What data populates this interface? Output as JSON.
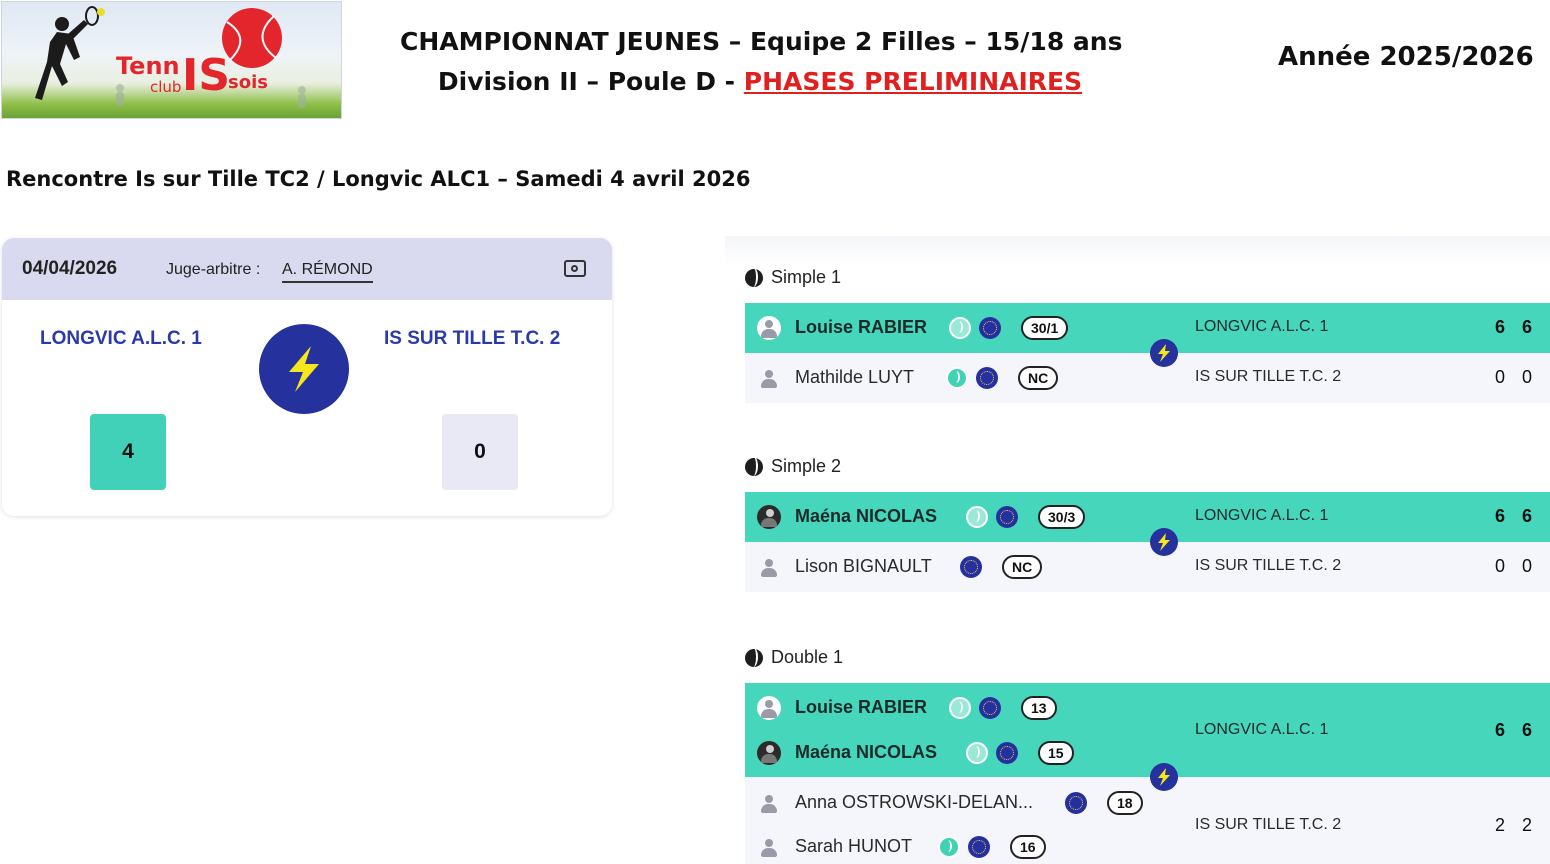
{
  "header": {
    "logo_text": "TennISclub ISsois",
    "title_line1": "CHAMPIONNAT JEUNES – Equipe 2 Filles – 15/18 ans",
    "title_line2_prefix": "Division II – Poule D - ",
    "title_line2_highlight": "PHASES PRELIMINAIRES",
    "season": "Année 2025/2026"
  },
  "encounter_title": "Rencontre Is sur Tille TC2 / Longvic ALC1 – Samedi 4 avril 2026",
  "summary": {
    "date": "04/04/2026",
    "judge_label": "Juge-arbitre :",
    "judge_name": "A. RÉMOND",
    "home_team": "LONGVIC A.L.C. 1",
    "away_team": "IS SUR TILLE T.C. 2",
    "home_score": "4",
    "away_score": "0"
  },
  "matches": [
    {
      "title": "Simple 1",
      "winner": {
        "players": [
          {
            "name": "Louise RABIER",
            "rank": "30/1"
          }
        ],
        "club": "LONGVIC A.L.C. 1",
        "sets": [
          "6",
          "6"
        ]
      },
      "loser": {
        "players": [
          {
            "name": "Mathilde LUYT",
            "rank": "NC"
          }
        ],
        "club": "IS SUR TILLE T.C. 2",
        "sets": [
          "0",
          "0"
        ]
      }
    },
    {
      "title": "Simple 2",
      "winner": {
        "players": [
          {
            "name": "Maéna NICOLAS",
            "rank": "30/3"
          }
        ],
        "club": "LONGVIC A.L.C. 1",
        "sets": [
          "6",
          "6"
        ]
      },
      "loser": {
        "players": [
          {
            "name": "Lison BIGNAULT",
            "rank": "NC"
          }
        ],
        "club": "IS SUR TILLE T.C. 2",
        "sets": [
          "0",
          "0"
        ]
      }
    },
    {
      "title": "Double 1",
      "winner": {
        "players": [
          {
            "name": "Louise RABIER",
            "rank": "13"
          },
          {
            "name": "Maéna NICOLAS",
            "rank": "15"
          }
        ],
        "club": "LONGVIC A.L.C. 1",
        "sets": [
          "6",
          "6"
        ]
      },
      "loser": {
        "players": [
          {
            "name": "Anna OSTROWSKI-DELAN...",
            "rank": "18"
          },
          {
            "name": "Sarah HUNOT",
            "rank": "16"
          }
        ],
        "club": "IS SUR TILLE T.C. 2",
        "sets": [
          "2",
          "2"
        ]
      }
    }
  ],
  "colors": {
    "winner_row": "#45d6bc",
    "loser_row": "#f5f6fb",
    "summary_header": "#d9d9f0",
    "team_name": "#2a3aa8",
    "bolt_circle": "#25319c",
    "bolt": "#f7e61c",
    "phase_highlight": "#e01f1f"
  }
}
